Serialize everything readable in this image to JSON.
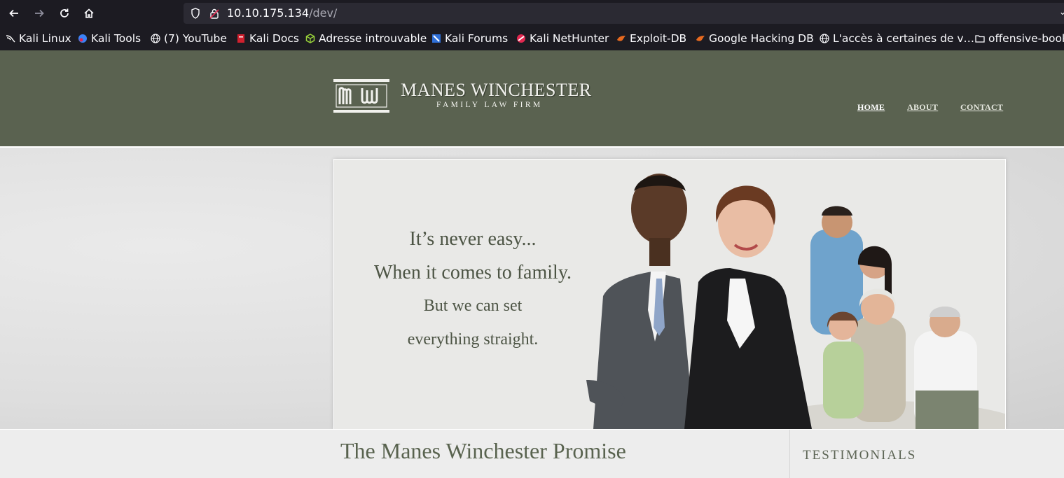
{
  "browser": {
    "url_host": "10.10.175.134",
    "url_path": "/dev/",
    "icons": {
      "back": "arrow-left-icon",
      "forward": "arrow-right-icon",
      "reload": "reload-icon",
      "home": "home-icon",
      "shield": "shield-icon",
      "lock": "insecure-lock-icon"
    },
    "bookmarks": [
      {
        "label": "Kali Linux",
        "icon": "kali-dragon-icon"
      },
      {
        "label": "Kali Tools",
        "icon": "kali-tools-icon"
      },
      {
        "label": "(7) YouTube",
        "icon": "globe-icon"
      },
      {
        "label": "Kali Docs",
        "icon": "kali-docs-icon"
      },
      {
        "label": "Adresse introuvable",
        "icon": "cube-icon"
      },
      {
        "label": "Kali Forums",
        "icon": "kali-forums-icon"
      },
      {
        "label": "Kali NetHunter",
        "icon": "nethunter-icon"
      },
      {
        "label": "Exploit-DB",
        "icon": "exploit-db-icon"
      },
      {
        "label": "Google Hacking DB",
        "icon": "ghdb-icon"
      },
      {
        "label": "L'accès à certaines de v…",
        "icon": "globe-icon"
      },
      {
        "label": "offensive-book",
        "icon": "folder-icon"
      }
    ]
  },
  "site": {
    "logo": {
      "mark": "MW",
      "title": "MANES WINCHESTER",
      "subtitle": "FAMILY LAW FIRM"
    },
    "nav": [
      {
        "label": "HOME",
        "active": true
      },
      {
        "label": "ABOUT",
        "active": false
      },
      {
        "label": "CONTACT",
        "active": false
      }
    ],
    "hero": {
      "lines": [
        "It’s never easy...",
        "When it comes to family.",
        "But we can set",
        "everything straight."
      ]
    },
    "promise_heading": "The Manes Winchester Promise",
    "testimonials_heading": "TESTIMONIALS"
  },
  "colors": {
    "header_bg": "#5a6250",
    "heading_text": "#59634f",
    "chrome_bg": "#1c1b22"
  }
}
